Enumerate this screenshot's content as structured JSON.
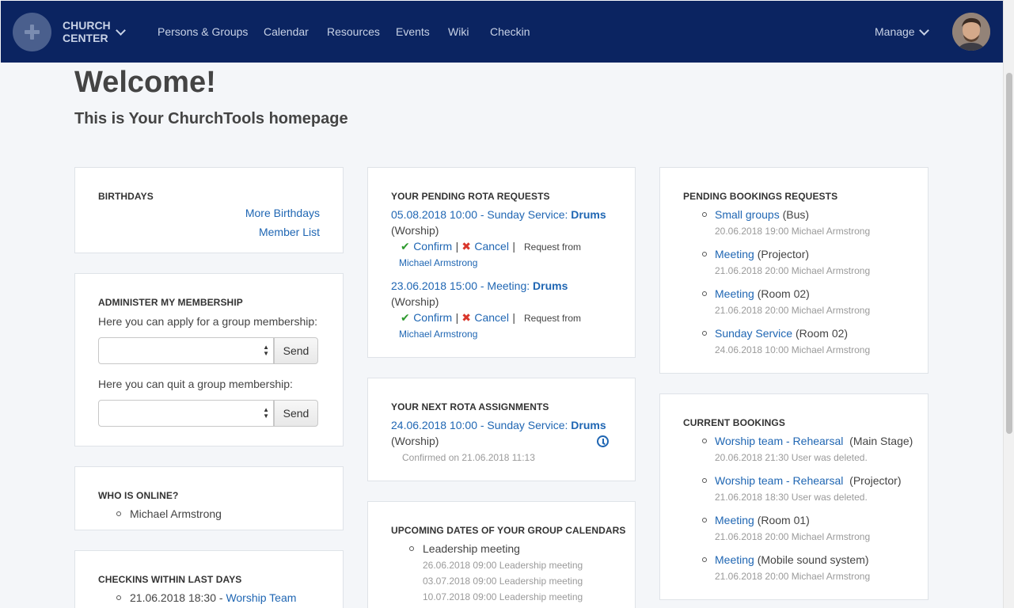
{
  "nav": {
    "brand_line1": "CHURCH",
    "brand_line2": "CENTER",
    "items": [
      "Persons & Groups",
      "Calendar",
      "Resources",
      "Events",
      "Wiki",
      "Checkin"
    ],
    "manage": "Manage"
  },
  "page": {
    "title": "Welcome!",
    "subtitle": "This is Your ChurchTools homepage"
  },
  "birthdays": {
    "title": "BIRTHDAYS",
    "more_link": "More Birthdays",
    "member_link": "Member List"
  },
  "membership": {
    "title": "ADMINISTER MY MEMBERSHIP",
    "apply_text": "Here you can apply for a group membership:",
    "quit_text": "Here you can quit a group membership:",
    "send_label": "Send"
  },
  "online": {
    "title": "WHO IS ONLINE?",
    "users": [
      "Michael Armstrong"
    ]
  },
  "checkins": {
    "title": "CHECKINS WITHIN LAST DAYS",
    "items": [
      {
        "time": "21.06.2018 18:30 - ",
        "group": "Worship Team"
      }
    ]
  },
  "pending_rota": {
    "title": "YOUR PENDING ROTA REQUESTS",
    "items": [
      {
        "event": "05.08.2018 10:00 - Sunday Service: ",
        "role": "Drums",
        "group": "(Worship)",
        "confirm": "Confirm",
        "cancel": "Cancel",
        "request_from": "Request from",
        "requester": "Michael Armstrong"
      },
      {
        "event": "23.06.2018 15:00 - Meeting: ",
        "role": "Drums",
        "group": "(Worship)",
        "confirm": "Confirm",
        "cancel": "Cancel",
        "request_from": "Request from",
        "requester": "Michael Armstrong"
      }
    ]
  },
  "next_rota": {
    "title": "YOUR NEXT ROTA ASSIGNMENTS",
    "event": "24.06.2018 10:00 - Sunday Service: ",
    "role": "Drums",
    "group": "(Worship)",
    "confirmed": "Confirmed on 21.06.2018 11:13"
  },
  "upcoming": {
    "title": "UPCOMING DATES OF YOUR GROUP CALENDARS",
    "name": "Leadership meeting",
    "dates": [
      "26.06.2018 09:00 Leadership meeting",
      "03.07.2018 09:00 Leadership meeting",
      "10.07.2018 09:00 Leadership meeting"
    ]
  },
  "pending_bookings": {
    "title": "PENDING BOOKINGS REQUESTS",
    "items": [
      {
        "link": "Small groups",
        "resource": " (Bus)",
        "meta": "20.06.2018 19:00 Michael Armstrong"
      },
      {
        "link": "Meeting",
        "resource": " (Projector)",
        "meta": "21.06.2018 20:00 Michael Armstrong"
      },
      {
        "link": "Meeting",
        "resource": " (Room 02)",
        "meta": "21.06.2018 20:00 Michael Armstrong"
      },
      {
        "link": "Sunday Service",
        "resource": " (Room 02)",
        "meta": "24.06.2018 10:00 Michael Armstrong"
      }
    ]
  },
  "current_bookings": {
    "title": "CURRENT BOOKINGS",
    "items": [
      {
        "link": "Worship team - Rehearsal",
        "resource": "  (Main Stage)",
        "meta": "20.06.2018 21:30 User was deleted."
      },
      {
        "link": "Worship team - Rehearsal",
        "resource": "  (Projector)",
        "meta": "21.06.2018 18:30 User was deleted."
      },
      {
        "link": "Meeting",
        "resource": " (Room 01)",
        "meta": "21.06.2018 20:00 Michael Armstrong"
      },
      {
        "link": "Meeting",
        "resource": " (Mobile sound system)",
        "meta": "21.06.2018 20:00 Michael Armstrong"
      }
    ]
  }
}
